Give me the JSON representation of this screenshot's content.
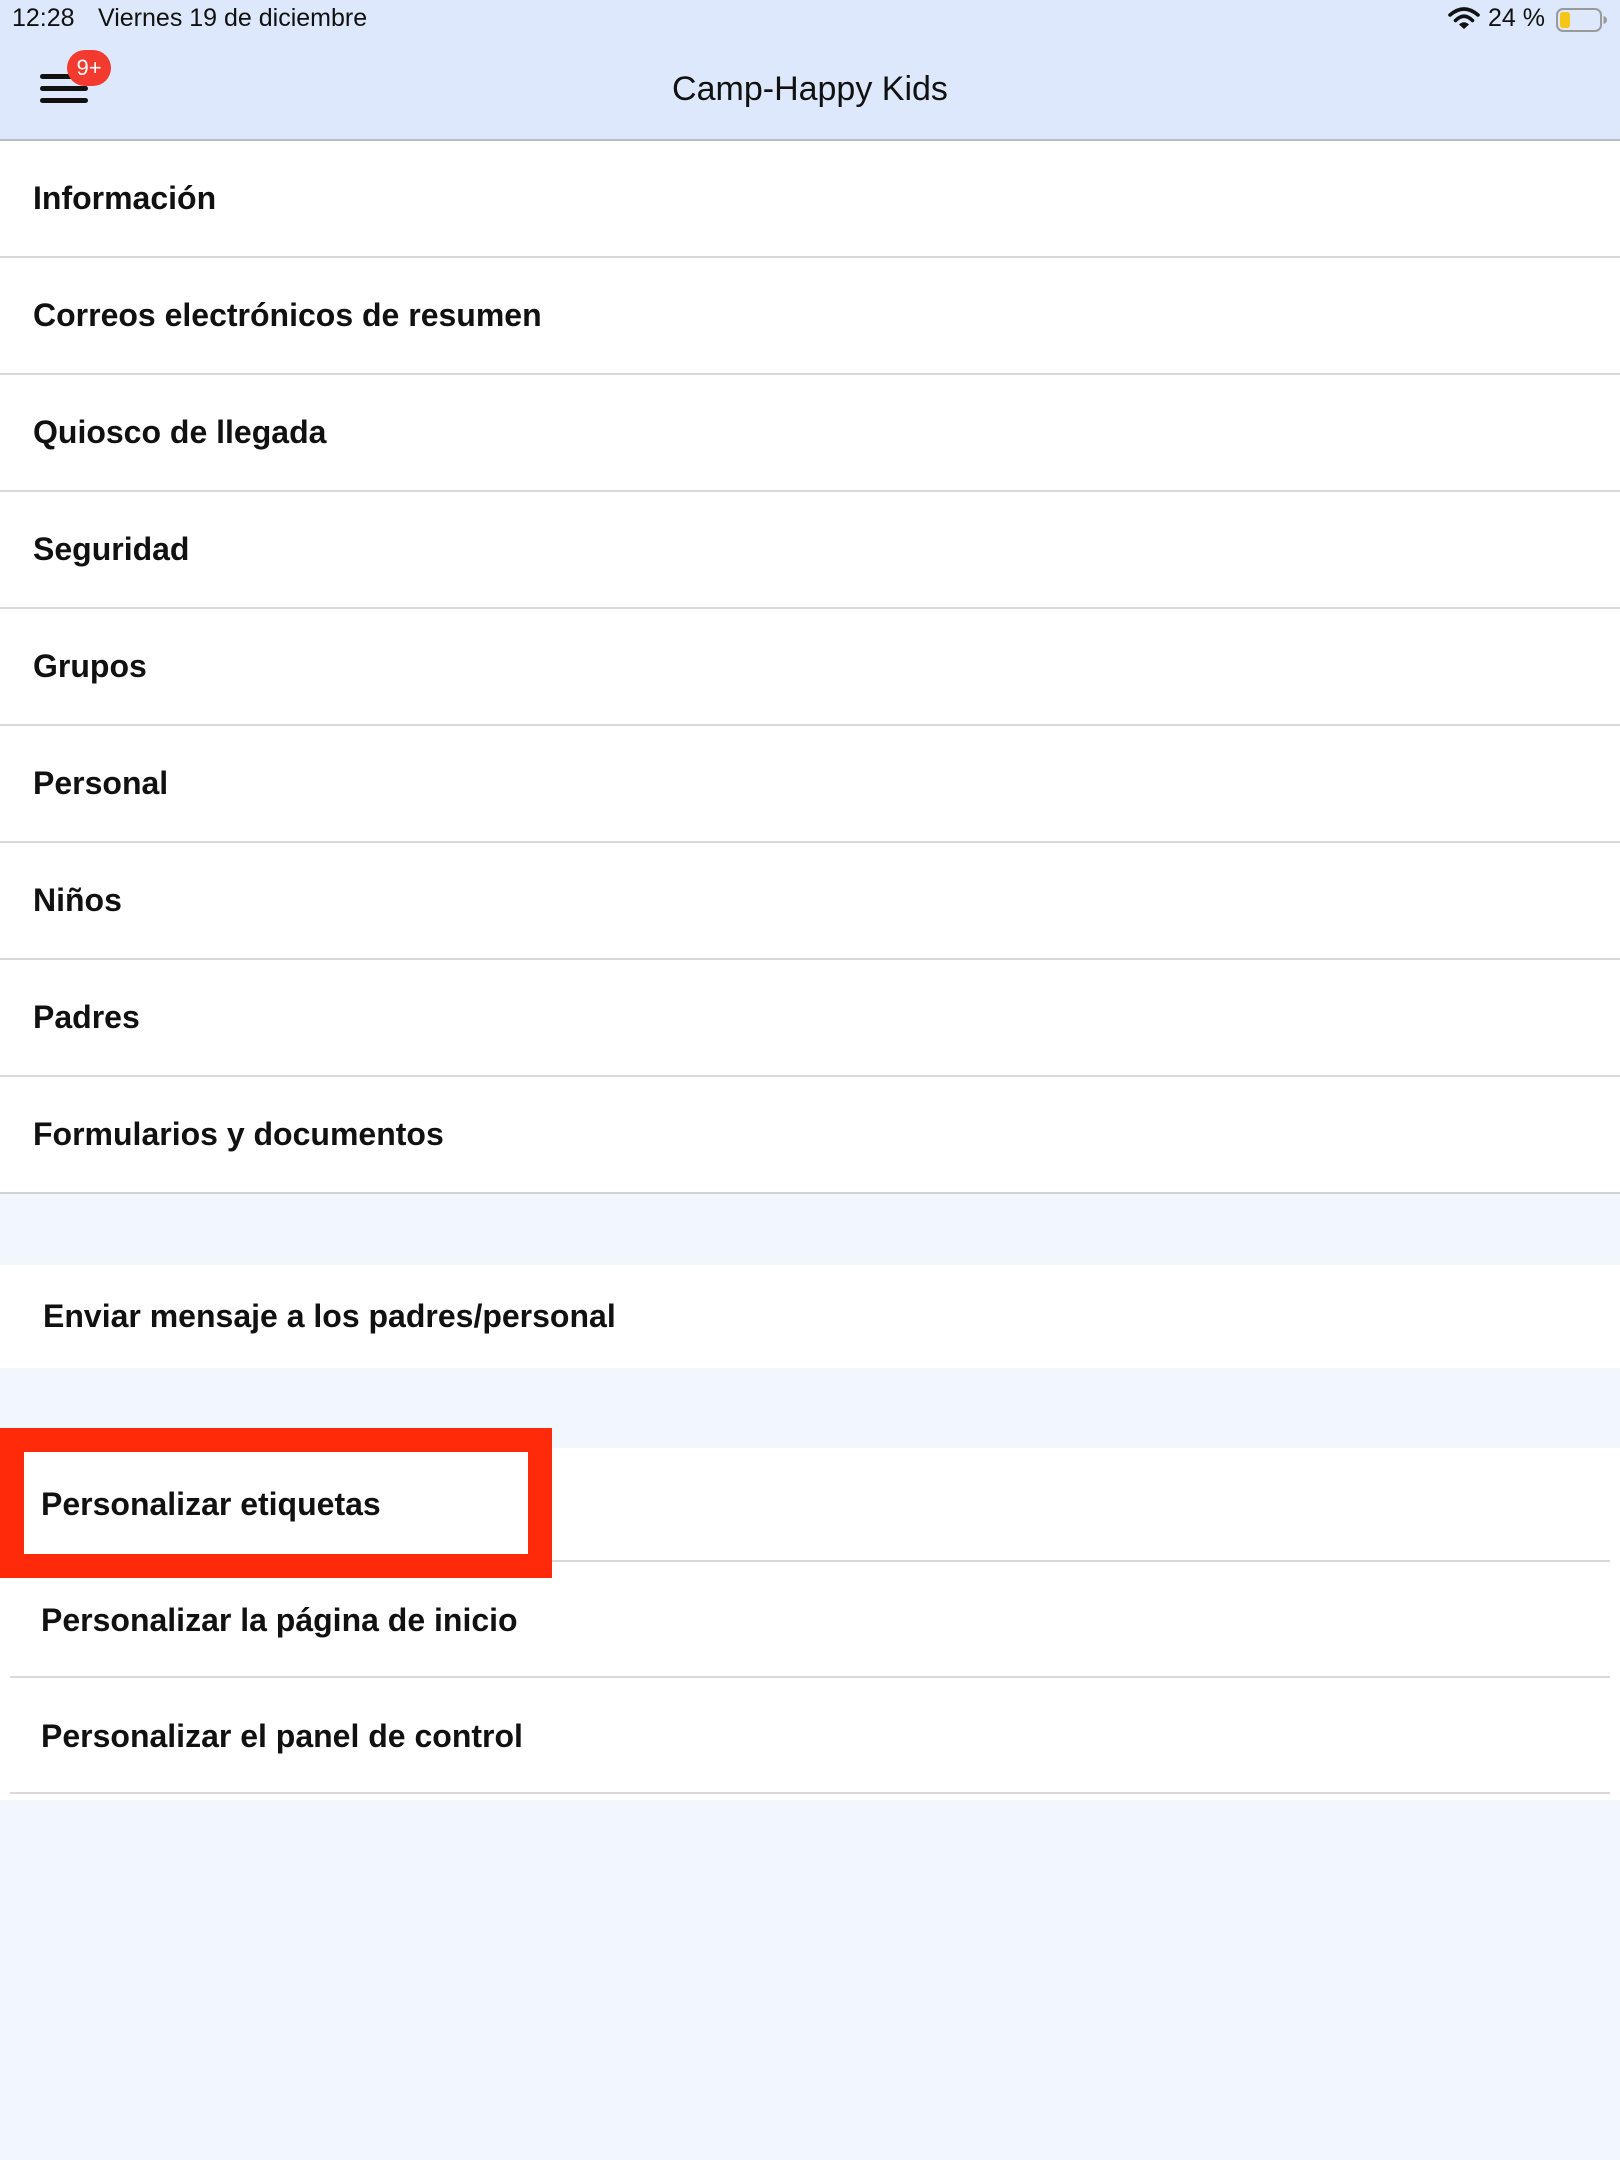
{
  "status_bar": {
    "time": "12:28",
    "date": "Viernes 19 de diciembre",
    "battery": "24 %",
    "wifi_icon": "wifi-icon",
    "battery_icon": "battery-icon"
  },
  "nav": {
    "title": "Camp-Happy Kids",
    "menu_icon": "hamburger-menu-icon",
    "badge": "9+"
  },
  "menu": {
    "items": [
      {
        "label": "Información"
      },
      {
        "label": "Correos electrónicos de resumen"
      },
      {
        "label": "Quiosco de llegada"
      },
      {
        "label": "Seguridad"
      },
      {
        "label": "Grupos"
      },
      {
        "label": "Personal"
      },
      {
        "label": "Niños"
      },
      {
        "label": "Padres"
      },
      {
        "label": "Formularios y documentos"
      }
    ]
  },
  "message": {
    "label": "Enviar mensaje a los padres/personal"
  },
  "customize": {
    "items": [
      {
        "label": "Personalizar etiquetas",
        "highlighted": true
      },
      {
        "label": "Personalizar la página de inicio"
      },
      {
        "label": "Personalizar el panel de control"
      }
    ]
  },
  "colors": {
    "header_bg": "#dde8fc",
    "page_bg": "#f2f6fd",
    "badge": "#f23a2f",
    "highlight": "#ff2a0a",
    "battery_fill": "#f5c518"
  }
}
